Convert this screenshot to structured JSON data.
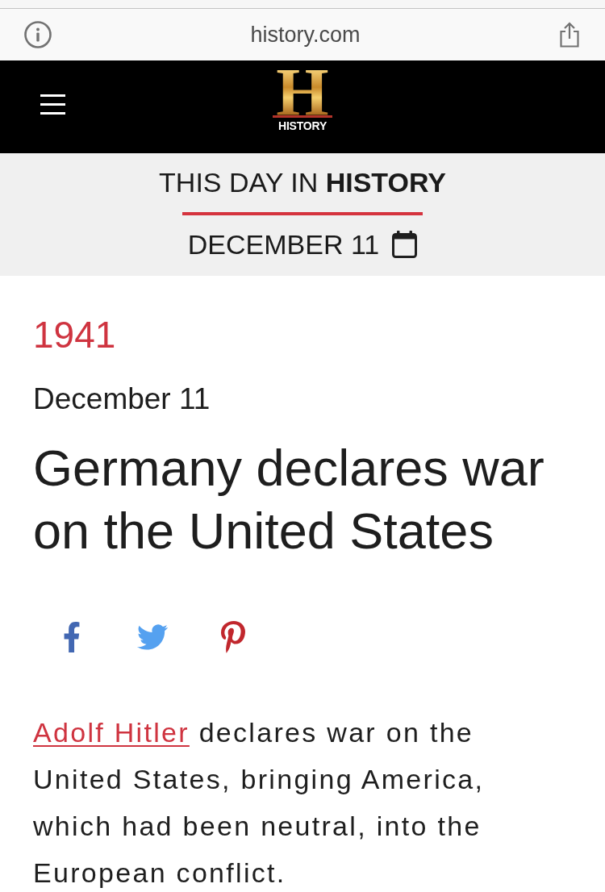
{
  "browser_bar": {
    "url": "history.com"
  },
  "site_header": {
    "logo_mark": "H",
    "logo_wordmark": "HISTORY"
  },
  "banner": {
    "title": "THIS DAY IN **HISTORY**",
    "date": "DECEMBER 11"
  },
  "article": {
    "year": "1941",
    "date": "December 11",
    "headline": "Germany declares war on the United States",
    "lead": {
      "link": "Adolf Hitler",
      "text": "declares war on the United States, bringing America, which had been neutral, into the European conflict."
    }
  }
}
